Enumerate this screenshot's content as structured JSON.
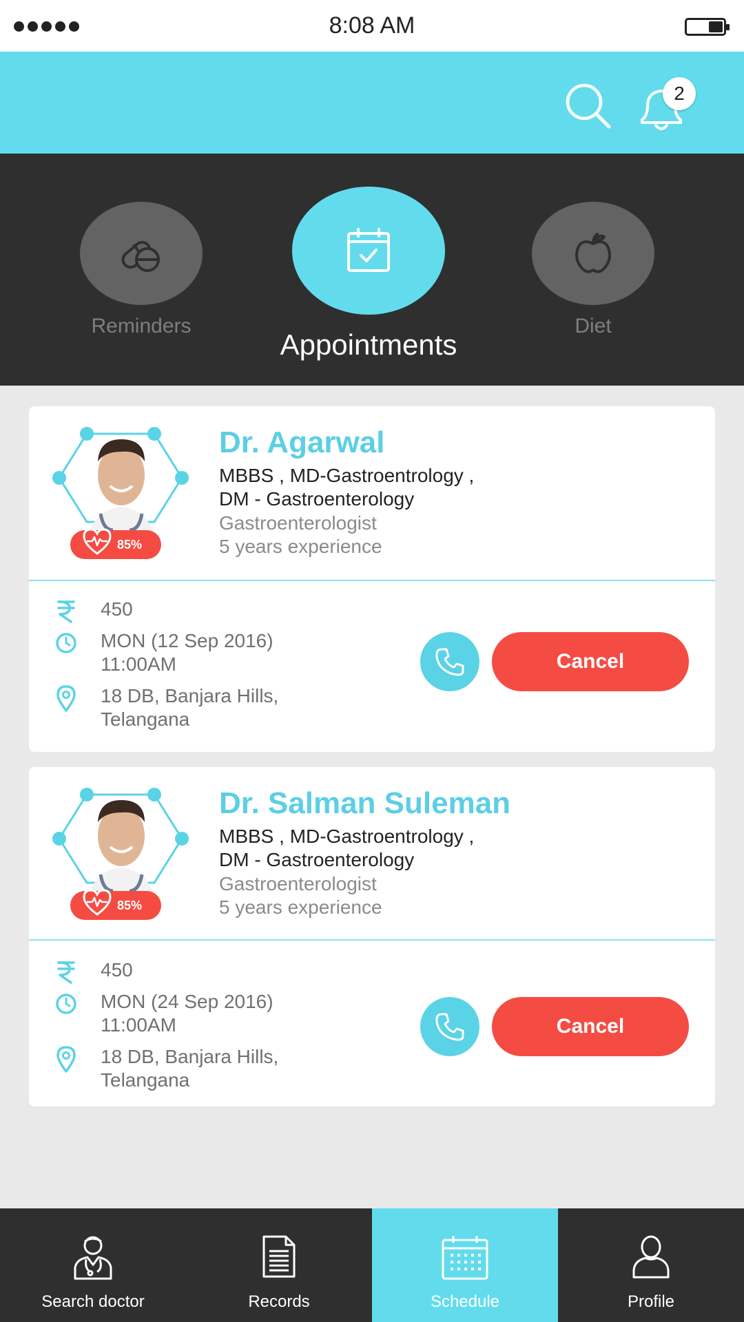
{
  "status_bar": {
    "time": "8:08 AM"
  },
  "header": {
    "notification_count": "2"
  },
  "categories": [
    {
      "label": "Reminders",
      "icon": "pills-icon",
      "active": false
    },
    {
      "label": "Appointments",
      "icon": "calendar-check-icon",
      "active": true
    },
    {
      "label": "Diet",
      "icon": "apple-icon",
      "active": false
    }
  ],
  "appointments": [
    {
      "doctor_name": "Dr. Agarwal",
      "qualifications_line1": "MBBS , MD-Gastroentrology ,",
      "qualifications_line2": "DM - Gastroenterology",
      "specialty": "Gastroenterologist",
      "experience": "5 years experience",
      "score": "85%",
      "fee": "450",
      "date": "MON (12 Sep 2016)",
      "time": "11:00AM",
      "address_line1": "18 DB, Banjara Hills,",
      "address_line2": "Telangana",
      "cancel_label": "Cancel"
    },
    {
      "doctor_name": "Dr. Salman Suleman",
      "qualifications_line1": "MBBS , MD-Gastroentrology ,",
      "qualifications_line2": "DM - Gastroenterology",
      "specialty": "Gastroenterologist",
      "experience": "5 years experience",
      "score": "85%",
      "fee": "450",
      "date": "MON (24 Sep 2016)",
      "time": "11:00AM",
      "address_line1": "18 DB, Banjara Hills,",
      "address_line2": "Telangana",
      "cancel_label": "Cancel"
    }
  ],
  "bottom_nav": [
    {
      "label": "Search doctor",
      "icon": "doctor-icon",
      "active": false
    },
    {
      "label": "Records",
      "icon": "document-icon",
      "active": false
    },
    {
      "label": "Schedule",
      "icon": "calendar-icon",
      "active": true
    },
    {
      "label": "Profile",
      "icon": "user-icon",
      "active": false
    }
  ],
  "colors": {
    "accent": "#62dced",
    "dark": "#2f2f30",
    "danger": "#f44c43",
    "doctor_name": "#5ccfe3"
  }
}
